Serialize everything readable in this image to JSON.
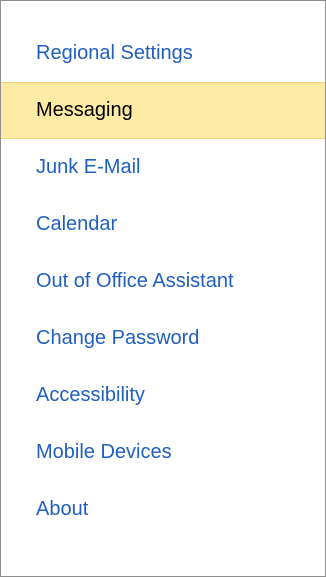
{
  "options_nav": {
    "selected_index": 1,
    "colors": {
      "link": "#1f5fbf",
      "selected_text": "#000000",
      "selected_background": "#fdeaa5",
      "selected_border": "#f3d27a",
      "panel_border": "#8e8e8e"
    },
    "items": [
      {
        "label": "Regional Settings"
      },
      {
        "label": "Messaging"
      },
      {
        "label": "Junk E-Mail"
      },
      {
        "label": "Calendar"
      },
      {
        "label": "Out of Office Assistant"
      },
      {
        "label": "Change Password"
      },
      {
        "label": "Accessibility"
      },
      {
        "label": "Mobile Devices"
      },
      {
        "label": "About"
      }
    ]
  }
}
